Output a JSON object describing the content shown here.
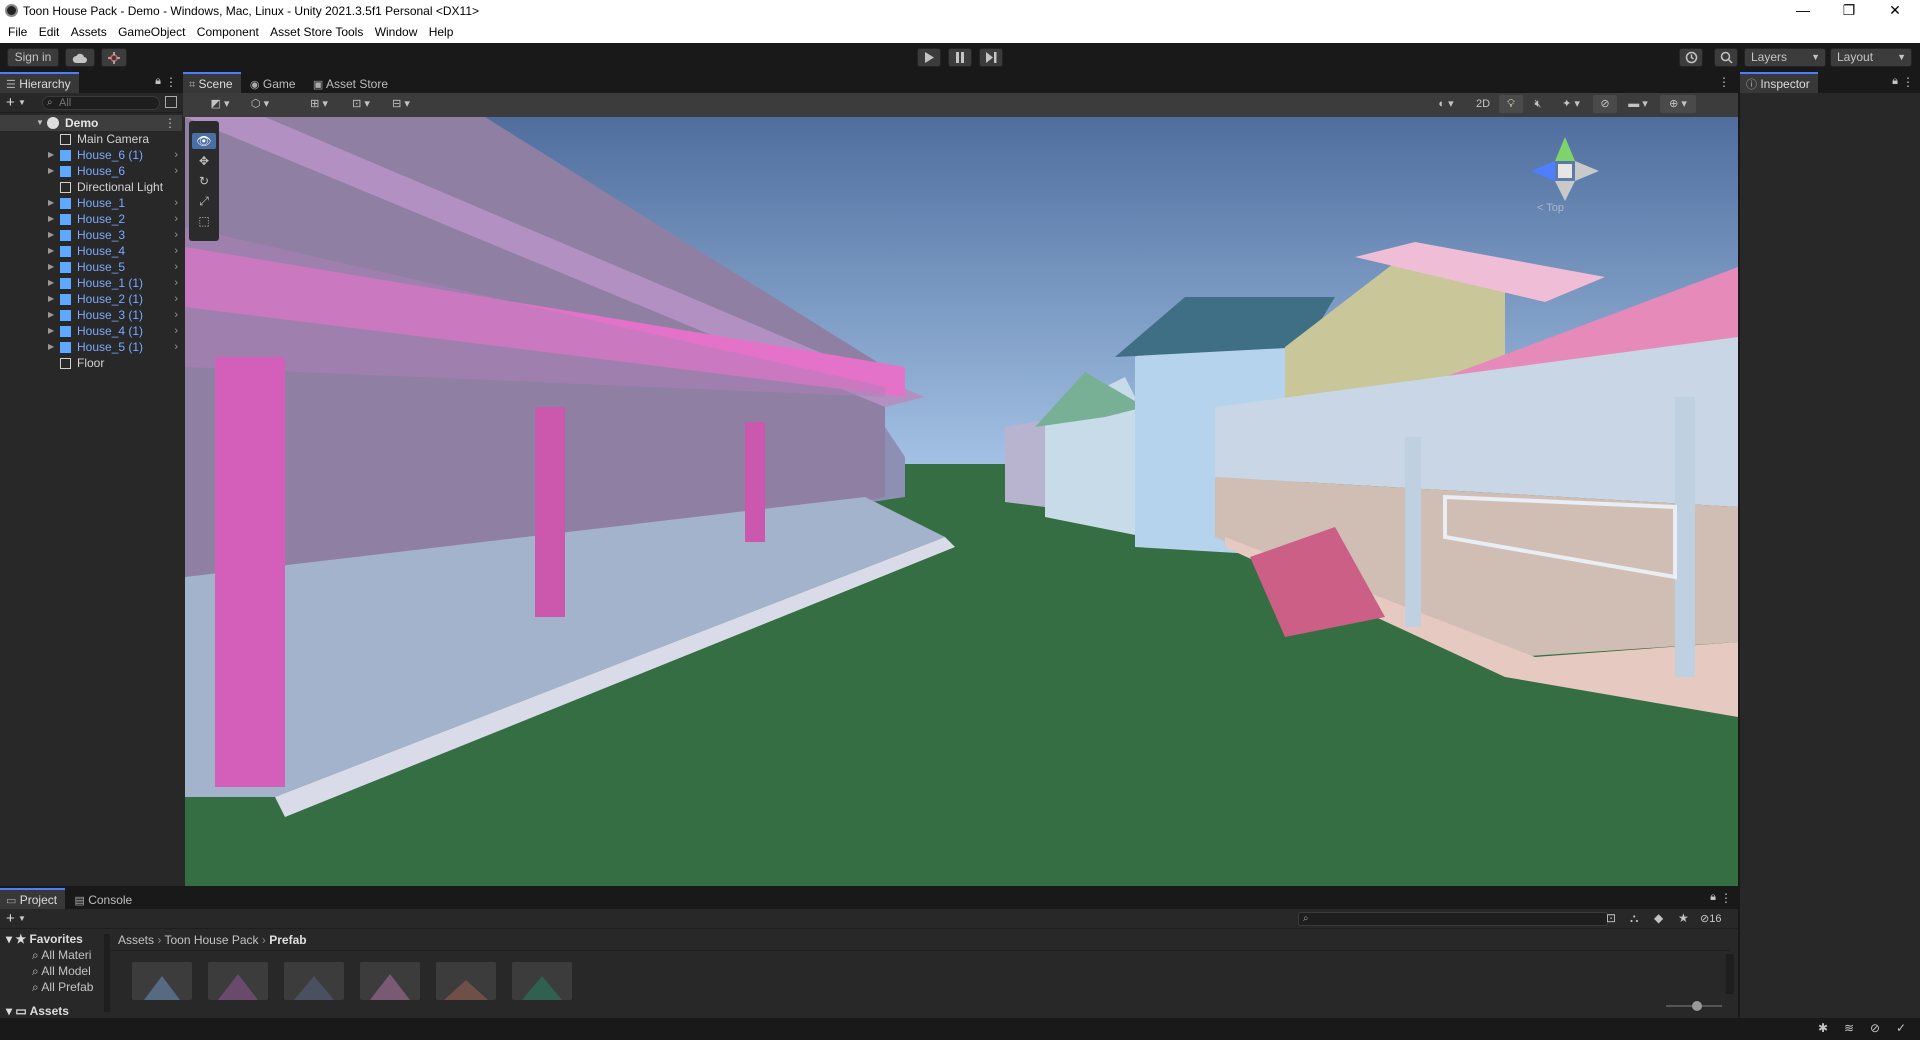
{
  "window": {
    "title": "Toon House Pack - Demo - Windows, Mac, Linux - Unity 2021.3.5f1 Personal <DX11>",
    "minimize": "—",
    "maximize": "❐",
    "close": "✕"
  },
  "menu": [
    "File",
    "Edit",
    "Assets",
    "GameObject",
    "Component",
    "Asset Store Tools",
    "Window",
    "Help"
  ],
  "toolbar": {
    "sign_in": "Sign in",
    "layers": "Layers",
    "layout": "Layout"
  },
  "hierarchy": {
    "tab": "Hierarchy",
    "search_placeholder": "All",
    "scene_name": "Demo",
    "items": [
      {
        "label": "Main Camera",
        "prefab": false,
        "expand": false
      },
      {
        "label": "House_6 (1)",
        "prefab": true,
        "expand": true
      },
      {
        "label": "House_6",
        "prefab": true,
        "expand": true
      },
      {
        "label": "Directional Light",
        "prefab": false,
        "expand": false
      },
      {
        "label": "House_1",
        "prefab": true,
        "expand": true
      },
      {
        "label": "House_2",
        "prefab": true,
        "expand": true
      },
      {
        "label": "House_3",
        "prefab": true,
        "expand": true
      },
      {
        "label": "House_4",
        "prefab": true,
        "expand": true
      },
      {
        "label": "House_5",
        "prefab": true,
        "expand": true
      },
      {
        "label": "House_1 (1)",
        "prefab": true,
        "expand": true
      },
      {
        "label": "House_2 (1)",
        "prefab": true,
        "expand": true
      },
      {
        "label": "House_3 (1)",
        "prefab": true,
        "expand": true
      },
      {
        "label": "House_4 (1)",
        "prefab": true,
        "expand": true
      },
      {
        "label": "House_5 (1)",
        "prefab": true,
        "expand": true
      },
      {
        "label": "Floor",
        "prefab": false,
        "expand": false
      }
    ]
  },
  "scene": {
    "tabs": [
      "Scene",
      "Game",
      "Asset Store"
    ],
    "btn_2d": "2D",
    "gizmo_label": "< Top"
  },
  "inspector": {
    "tab": "Inspector"
  },
  "project": {
    "tabs": [
      "Project",
      "Console"
    ],
    "favorites_label": "Favorites",
    "favorites": [
      "All Materi",
      "All Model",
      "All Prefab"
    ],
    "assets_label": "Assets",
    "breadcrumb": [
      "Assets",
      "Toon House Pack",
      "Prefab"
    ],
    "hidden_count": "16"
  },
  "colors": {
    "accent": "#4c7fff",
    "prefab_text": "#7ca9ff",
    "sky_top": "#4f6e9e",
    "sky_bottom": "#9dbbe0",
    "grass": "#356e43"
  }
}
